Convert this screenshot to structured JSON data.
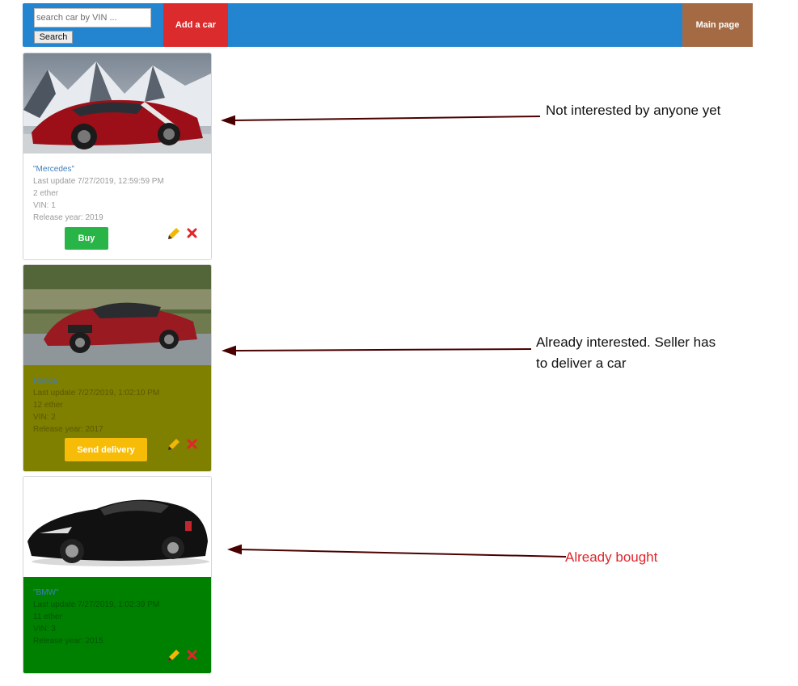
{
  "navbar": {
    "search_placeholder": "search car by VIN ...",
    "search_button": "Search",
    "add_car": "Add a car",
    "main_page": "Main page",
    "colors": {
      "bar": "#2385d0",
      "add_car": "#db2b2c",
      "main_page": "#a36a44"
    }
  },
  "cars": [
    {
      "name": "\"Mercedes\"",
      "last_update": "Last update 7/27/2019, 12:59:59 PM",
      "price": "2 ether",
      "vin": "VIN: 1",
      "release_year": "Release year: 2019",
      "action": "Buy",
      "action_color": "#28b446",
      "card_bg": "#ffffff",
      "image": "red-sports-car-snowy-mountains"
    },
    {
      "name": "Honda",
      "last_update": "Last update 7/27/2019, 1:02:10 PM",
      "price": "12 ether",
      "vin": "VIN: 2",
      "release_year": "Release year: 2017",
      "action": "Send delivery",
      "action_color": "#f7bc08",
      "card_bg": "#7f7f00",
      "image": "red-mercedes-sedan-road"
    },
    {
      "name": "\"BMW\"",
      "last_update": "Last update 7/27/2019, 1:02:39 PM",
      "price": "11 ether",
      "vin": "VIN: 3",
      "release_year": "Release year: 2015",
      "action": "",
      "card_bg": "#008000",
      "image": "black-supercar"
    }
  ],
  "annotations": [
    {
      "text": "Not interested by anyone yet",
      "color": "#111111"
    },
    {
      "text": "Already interested. Seller has to deliver a car",
      "color": "#111111"
    },
    {
      "text": "Already bought",
      "color": "#e0262b"
    }
  ],
  "icons": {
    "edit": "pencil-icon",
    "delete": "close-icon"
  }
}
